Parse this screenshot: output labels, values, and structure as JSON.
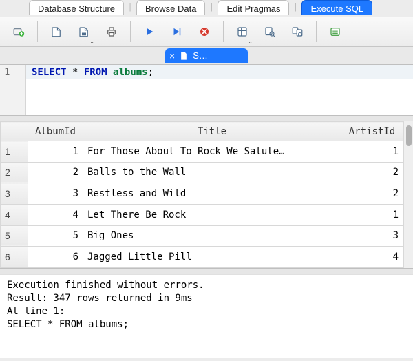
{
  "tabs": [
    {
      "label": "Database Structure",
      "active": false
    },
    {
      "label": "Browse Data",
      "active": false
    },
    {
      "label": "Edit Pragmas",
      "active": false
    },
    {
      "label": "Execute SQL",
      "active": true
    }
  ],
  "doc_tab": {
    "label": "S…"
  },
  "editor": {
    "line_number": "1",
    "keyword1": "SELECT",
    "star": " * ",
    "keyword2": "FROM",
    "space": " ",
    "ident": "albums",
    "semi": ";"
  },
  "columns": {
    "corner": "",
    "album_id": "AlbumId",
    "title": "Title",
    "artist_id": "ArtistId"
  },
  "rows": [
    {
      "n": "1",
      "album_id": "1",
      "title": "For Those About To Rock We Salute…",
      "artist_id": "1"
    },
    {
      "n": "2",
      "album_id": "2",
      "title": "Balls to the Wall",
      "artist_id": "2"
    },
    {
      "n": "3",
      "album_id": "3",
      "title": "Restless and Wild",
      "artist_id": "2"
    },
    {
      "n": "4",
      "album_id": "4",
      "title": "Let There Be Rock",
      "artist_id": "1"
    },
    {
      "n": "5",
      "album_id": "5",
      "title": "Big Ones",
      "artist_id": "3"
    },
    {
      "n": "6",
      "album_id": "6",
      "title": "Jagged Little Pill",
      "artist_id": "4"
    }
  ],
  "log": "Execution finished without errors.\nResult: 347 rows returned in 9ms\nAt line 1:\nSELECT * FROM albums;"
}
